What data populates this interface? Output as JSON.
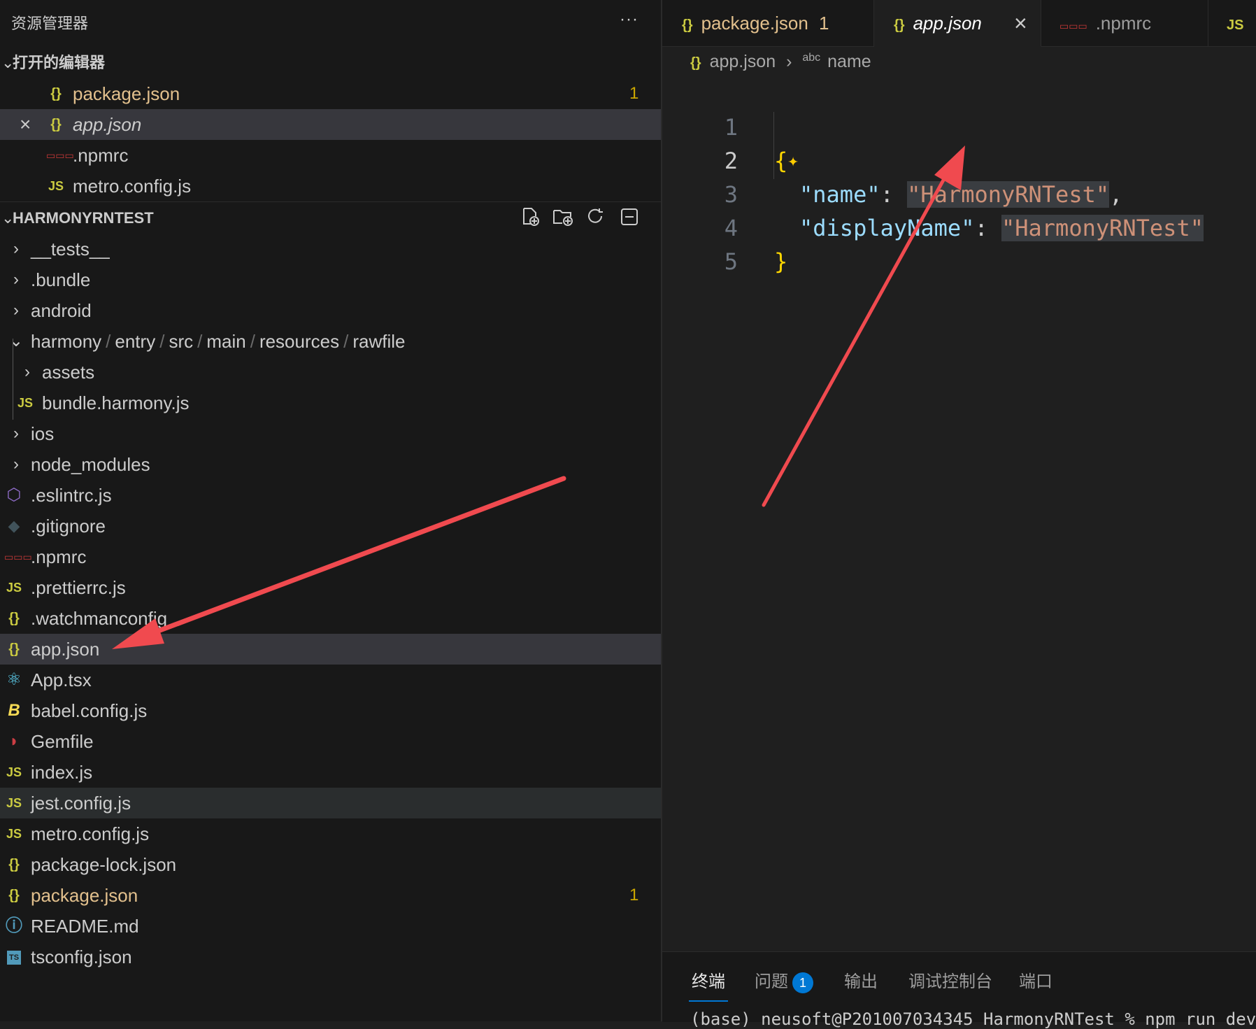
{
  "sidebar": {
    "title": "资源管理器",
    "more": "···",
    "open_editors": {
      "title": "打开的编辑器",
      "items": [
        {
          "label": "package.json",
          "badge": "1"
        },
        {
          "label": "app.json"
        },
        {
          "label": ".npmrc"
        },
        {
          "label": "metro.config.js"
        }
      ]
    },
    "project": {
      "title": "HARMONYRNTEST",
      "tree": [
        {
          "label": "__tests__"
        },
        {
          "label": ".bundle"
        },
        {
          "label": "android"
        },
        {
          "path": [
            "harmony",
            "entry",
            "src",
            "main",
            "resources",
            "rawfile"
          ]
        },
        {
          "label": "assets"
        },
        {
          "label": "bundle.harmony.js"
        },
        {
          "label": "ios"
        },
        {
          "label": "node_modules"
        },
        {
          "label": ".eslintrc.js"
        },
        {
          "label": ".gitignore"
        },
        {
          "label": ".npmrc"
        },
        {
          "label": ".prettierrc.js"
        },
        {
          "label": ".watchmanconfig"
        },
        {
          "label": "app.json"
        },
        {
          "label": "App.tsx"
        },
        {
          "label": "babel.config.js"
        },
        {
          "label": "Gemfile"
        },
        {
          "label": "index.js"
        },
        {
          "label": "jest.config.js"
        },
        {
          "label": "metro.config.js"
        },
        {
          "label": "package-lock.json"
        },
        {
          "label": "package.json",
          "badge": "1"
        },
        {
          "label": "README.md"
        },
        {
          "label": "tsconfig.json"
        }
      ]
    }
  },
  "editor": {
    "tabs": [
      {
        "label": "package.json",
        "badge": "1"
      },
      {
        "label": "app.json"
      },
      {
        "label": ".npmrc"
      }
    ],
    "breadcrumb": {
      "file": "app.json",
      "symbol_icon": "abc",
      "symbol": "name"
    },
    "lines": [
      {
        "n": "1",
        "open": "{"
      },
      {
        "n": "2",
        "key": "\"name\"",
        "colon": ": ",
        "value": "\"HarmonyRNTest\"",
        "tail": ","
      },
      {
        "n": "3",
        "key": "\"displayName\"",
        "colon": ": ",
        "value": "\"HarmonyRNTest\""
      },
      {
        "n": "4",
        "close": "}"
      },
      {
        "n": "5"
      }
    ]
  },
  "panel": {
    "tabs": [
      "终端",
      "问题",
      "输出",
      "调试控制台",
      "端口"
    ],
    "problems_count": "1",
    "terminal_line": "(base) neusoft@P201007034345 HarmonyRNTest % npm run dev"
  },
  "colors": {
    "arrow": "#f04a4f",
    "json_icon": "#cbcb41",
    "npm_icon": "#cb3837",
    "modified": "#e2c08d",
    "accent": "#0078d4"
  }
}
